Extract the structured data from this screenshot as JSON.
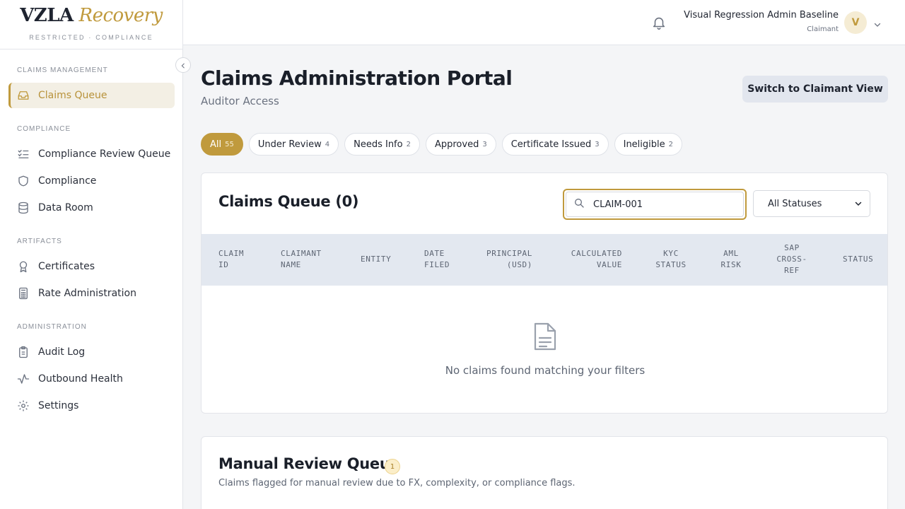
{
  "brand": {
    "logo_part1": "VZLA",
    "logo_part2": "Recovery",
    "subtitle": "RESTRICTED · COMPLIANCE"
  },
  "sidebar": {
    "sections": [
      {
        "label": "CLAIMS MANAGEMENT"
      },
      {
        "label": "COMPLIANCE"
      },
      {
        "label": "ARTIFACTS"
      },
      {
        "label": "ADMINISTRATION"
      }
    ],
    "items": [
      {
        "label": "Claims Queue",
        "icon": "inbox-icon",
        "active": true
      },
      {
        "label": "Compliance Review Queue",
        "icon": "checklist-icon"
      },
      {
        "label": "Compliance",
        "icon": "shield-icon"
      },
      {
        "label": "Data Room",
        "icon": "database-icon"
      },
      {
        "label": "Certificates",
        "icon": "award-icon"
      },
      {
        "label": "Rate Administration",
        "icon": "calculator-icon"
      },
      {
        "label": "Audit Log",
        "icon": "clipboard-icon"
      },
      {
        "label": "Outbound Health",
        "icon": "pulse-icon"
      },
      {
        "label": "Settings",
        "icon": "gear-icon"
      }
    ]
  },
  "header": {
    "user_name": "Visual Regression Admin Baseline",
    "user_role": "Claimant",
    "avatar_initial": "V"
  },
  "main": {
    "title": "Claims Administration Portal",
    "subtitle": "Auditor Access",
    "switch_button": "Switch to Claimant View",
    "tabs": [
      {
        "label": "All",
        "count": "55",
        "active": true
      },
      {
        "label": "Under Review",
        "count": "4"
      },
      {
        "label": "Needs Info",
        "count": "2"
      },
      {
        "label": "Approved",
        "count": "3"
      },
      {
        "label": "Certificate Issued",
        "count": "3"
      },
      {
        "label": "Ineligible",
        "count": "2"
      }
    ]
  },
  "queue": {
    "title": "Claims Queue (0)",
    "search_value": "CLAIM-001",
    "status_filter": "All Statuses",
    "columns": {
      "claim_id": "CLAIM\nID",
      "claimant_name": "CLAIMANT\nNAME",
      "entity": "ENTITY",
      "date_filed": "DATE\nFILED",
      "principal": "PRINCIPAL\n(USD)",
      "calculated_value": "CALCULATED\nVALUE",
      "kyc_status": "KYC\nSTATUS",
      "aml_risk": "AML\nRISK",
      "sap_cross_ref": "SAP\nCROSS-\nREF",
      "status": "STATUS"
    },
    "empty_message": "No claims found matching your filters"
  },
  "manual_review": {
    "title": "Manual Review Queue",
    "count": "1",
    "description": "Claims flagged for manual review due to FX, complexity, or compliance flags."
  },
  "colors": {
    "accent": "#c09a3d",
    "table_header_bg": "#e3e8f0"
  }
}
